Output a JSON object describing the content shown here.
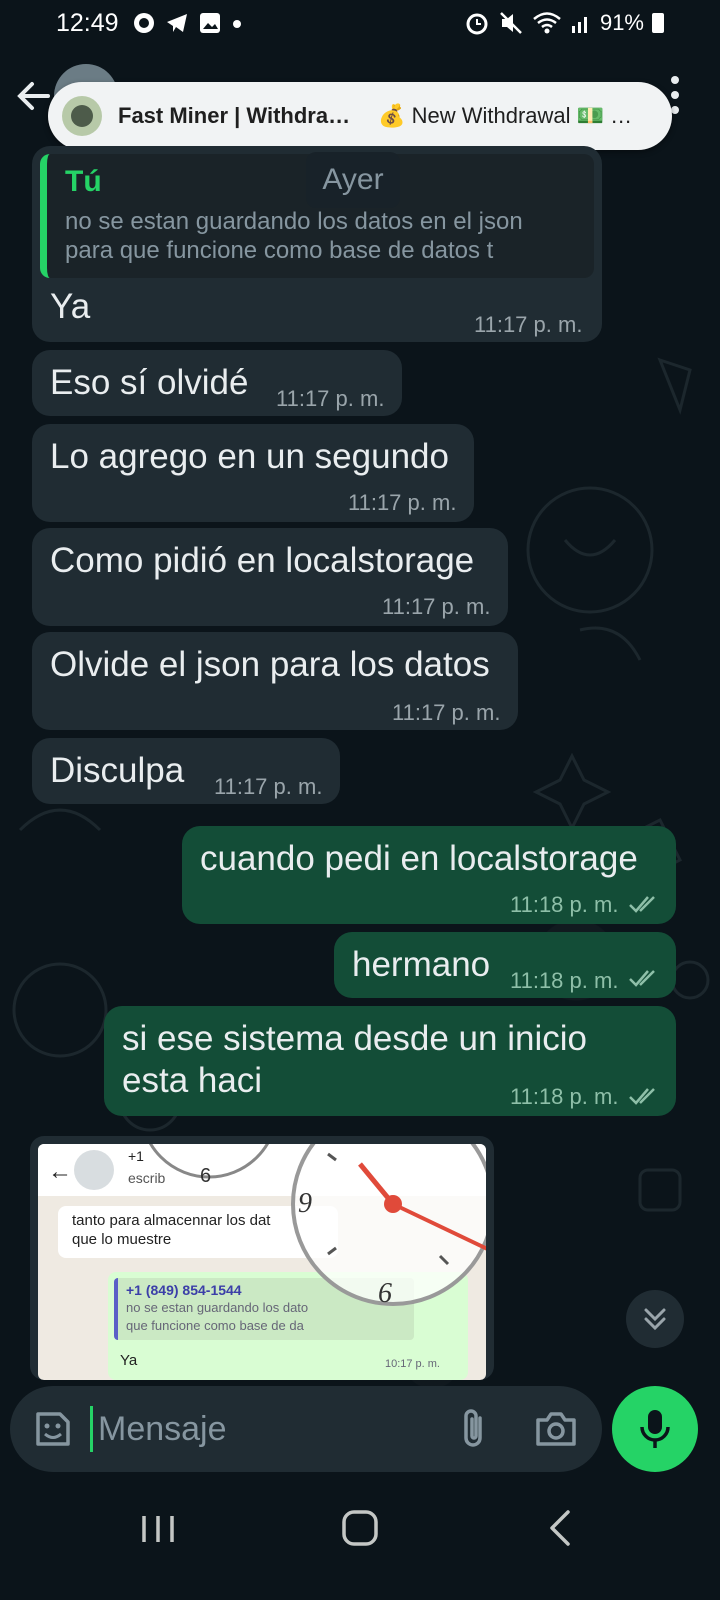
{
  "status_bar": {
    "time": "12:49",
    "battery": "91%"
  },
  "notification": {
    "title": "Fast Miner | Withdra…",
    "text": "💰 New Withdrawal 💵 …"
  },
  "date_chip": "Ayer",
  "quoted_message": {
    "author": "Tú",
    "text": "no se estan guardando los datos en el json para que funcione como base de datos t"
  },
  "messages": [
    {
      "direction": "in",
      "text": "Ya",
      "time": "11:17 p. m."
    },
    {
      "direction": "in",
      "text": "Eso sí olvidé",
      "time": "11:17 p. m."
    },
    {
      "direction": "in",
      "text": "Lo agrego en un segundo",
      "time": "11:17 p. m."
    },
    {
      "direction": "in",
      "text": "Como pidió en localstorage",
      "time": "11:17 p. m."
    },
    {
      "direction": "in",
      "text": "Olvide el json para los datos",
      "time": "11:17 p. m."
    },
    {
      "direction": "in",
      "text": "Disculpa",
      "time": "11:17 p. m."
    },
    {
      "direction": "out",
      "text": "cuando pedi en localstorage",
      "time": "11:18 p. m.",
      "status": "read"
    },
    {
      "direction": "out",
      "text": "hermano",
      "time": "11:18 p. m.",
      "status": "read"
    },
    {
      "direction": "out",
      "text_lines": [
        "si ese sistema desde un inicio",
        "esta haci"
      ],
      "time": "11:18 p. m.",
      "status": "read"
    }
  ],
  "image_message": {
    "contact_name": "+1",
    "contact_status": "escrib",
    "incoming_text_lines": [
      "tanto para almacennar los dat",
      "que lo muestre"
    ],
    "quote_name": "+1 (849) 854-1544",
    "quote_lines": [
      "no se estan guardando los dato",
      "que funcione como base de da"
    ],
    "reply_text": "Ya",
    "reply_time": "10:17 p. m."
  },
  "input": {
    "placeholder": "Mensaje"
  },
  "icons": {
    "back": "back-arrow-icon",
    "menu": "overflow-menu-icon",
    "emoji": "sticker-icon",
    "attach": "paperclip-icon",
    "camera": "camera-icon",
    "mic": "microphone-icon",
    "scroll": "double-chevron-down-icon"
  },
  "colors": {
    "background": "#0b141a",
    "incoming_bubble": "#202c33",
    "outgoing_bubble": "#134d37",
    "accent": "#25d366"
  }
}
